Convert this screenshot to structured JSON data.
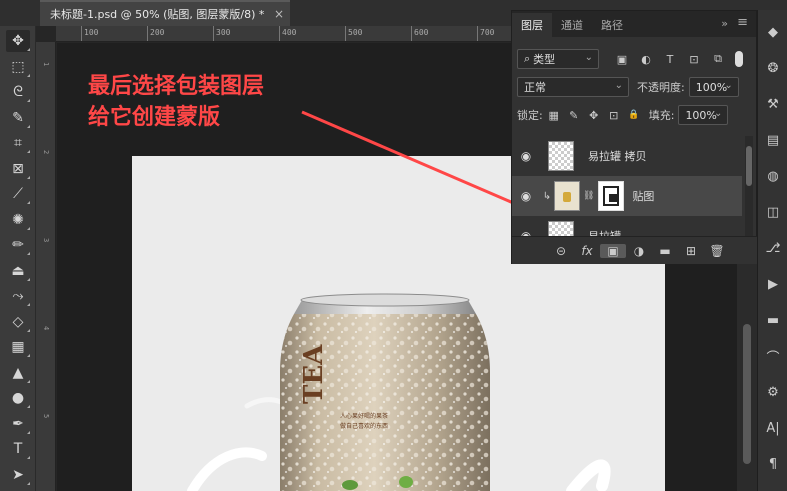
{
  "document": {
    "tab_title": "未标题-1.psd @ 50% (贴图, 图层蒙版/8) *",
    "close_glyph": "×"
  },
  "ruler": {
    "marks": [
      "100",
      "200",
      "300",
      "400",
      "500",
      "600",
      "700"
    ]
  },
  "ruler_left": {
    "marks": [
      "1",
      "2",
      "3",
      "4",
      "5"
    ]
  },
  "annotation": {
    "line1": "最后选择包装图层",
    "line2": "给它创建蒙版",
    "color": "#ff4747"
  },
  "can": {
    "brand": "TEA",
    "tagline1": "人心果好喝的果茶",
    "tagline2": "做自己喜欢的东西"
  },
  "tools": [
    {
      "icon": "move-icon",
      "glyph": "✥"
    },
    {
      "icon": "marquee-icon",
      "glyph": "⬚"
    },
    {
      "icon": "lasso-icon",
      "glyph": "ᘓ"
    },
    {
      "icon": "quick-select-icon",
      "glyph": "✎"
    },
    {
      "icon": "crop-icon",
      "glyph": "⌗"
    },
    {
      "icon": "frame-icon",
      "glyph": "⊠"
    },
    {
      "icon": "eyedropper-icon",
      "glyph": "⟋"
    },
    {
      "icon": "healing-icon",
      "glyph": "✺"
    },
    {
      "icon": "brush-icon",
      "glyph": "✏"
    },
    {
      "icon": "stamp-icon",
      "glyph": "⏏"
    },
    {
      "icon": "history-brush-icon",
      "glyph": "⤳"
    },
    {
      "icon": "eraser-icon",
      "glyph": "◇"
    },
    {
      "icon": "gradient-icon",
      "glyph": "▦"
    },
    {
      "icon": "blur-icon",
      "glyph": "▲"
    },
    {
      "icon": "dodge-icon",
      "glyph": "●"
    },
    {
      "icon": "pen-icon",
      "glyph": "✒"
    },
    {
      "icon": "type-icon",
      "glyph": "T"
    },
    {
      "icon": "path-select-icon",
      "glyph": "➤"
    }
  ],
  "layers_panel": {
    "tabs": [
      "图层",
      "通道",
      "路径"
    ],
    "collapse_glyph": "»",
    "menu_glyph": "≡",
    "filter": {
      "label": "类型",
      "search_glyph": "⌕",
      "chevron": "⌄"
    },
    "filter_icons": [
      "▣",
      "◐",
      "T",
      "⊡",
      "⧉"
    ],
    "blend_mode": {
      "value": "正常",
      "chevron": "⌄"
    },
    "opacity": {
      "label": "不透明度:",
      "value": "100%",
      "chevron": "⌄"
    },
    "lock": {
      "label": "锁定:",
      "icons": [
        "▦",
        "✎",
        "✥",
        "⊡",
        "🔒"
      ]
    },
    "fill": {
      "label": "填充:",
      "value": "100%",
      "chevron": "⌄"
    },
    "layers": [
      {
        "name": "易拉罐 拷贝",
        "visible_glyph": "◉",
        "selected": false,
        "has_mask": false
      },
      {
        "name": "贴图",
        "visible_glyph": "◉",
        "selected": true,
        "has_mask": true,
        "clip_glyph": "↳",
        "link_glyph": "⛓"
      },
      {
        "name": "易拉罐",
        "visible_glyph": "◉",
        "selected": false,
        "has_mask": false
      }
    ],
    "bottom_icons": [
      "⊝",
      "fx",
      "▣",
      "◑",
      "▬",
      "⊞",
      "🗑"
    ]
  },
  "dock_icons": [
    "◆",
    "❂",
    "⚒",
    "▤",
    "◍",
    "◫",
    "⎇",
    "▶",
    "▬",
    "⌒",
    "⚙",
    "A|",
    "¶"
  ]
}
